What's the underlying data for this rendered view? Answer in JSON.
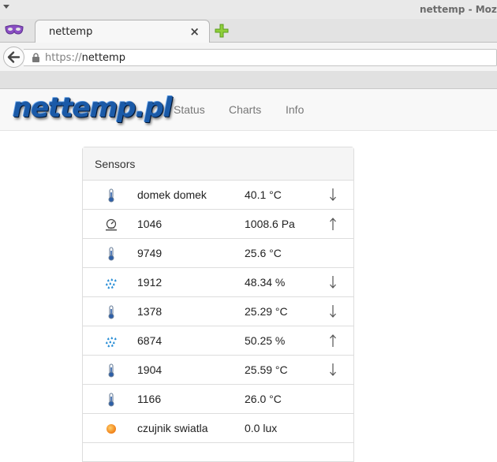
{
  "window": {
    "title": "nettemp - Mozilla"
  },
  "tab": {
    "title": "nettemp",
    "close": "×"
  },
  "url": {
    "scheme": "https://",
    "host": "nettemp"
  },
  "site": {
    "logo": "nettemp.pl",
    "nav": [
      "Status",
      "Charts",
      "Info"
    ]
  },
  "panel": {
    "title": "Sensors",
    "rows": [
      {
        "icon": "thermometer-icon",
        "name": "domek domek",
        "value": "40.1  °C",
        "trend": "down"
      },
      {
        "icon": "pressure-gauge-icon",
        "name": "1046",
        "value": "1008.6 Pa",
        "trend": "up"
      },
      {
        "icon": "thermometer-icon",
        "name": "9749",
        "value": "25.6  °C",
        "trend": "none"
      },
      {
        "icon": "humidity-icon",
        "name": "1912",
        "value": "48.34  %",
        "trend": "down"
      },
      {
        "icon": "thermometer-icon",
        "name": "1378",
        "value": "25.29  °C",
        "trend": "down"
      },
      {
        "icon": "humidity-icon",
        "name": "6874",
        "value": "50.25  %",
        "trend": "up"
      },
      {
        "icon": "thermometer-icon",
        "name": "1904",
        "value": "25.59  °C",
        "trend": "down"
      },
      {
        "icon": "thermometer-icon",
        "name": "1166",
        "value": "26.0  °C",
        "trend": "none"
      },
      {
        "icon": "light-sensor-icon",
        "name": "czujnik swiatla",
        "value": "0.0 lux",
        "trend": "none"
      }
    ]
  },
  "colors": {
    "accent": "#1a5aa8",
    "humidity": "#2b8fd6",
    "light": "#f07d14"
  }
}
